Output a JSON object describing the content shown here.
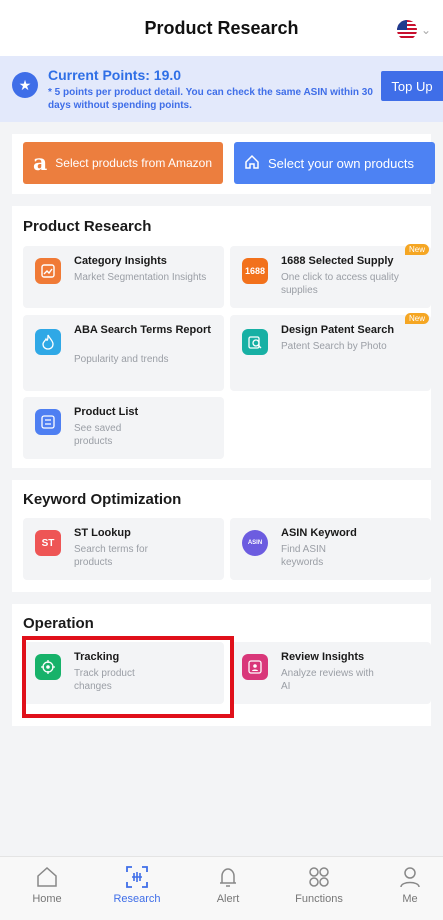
{
  "header": {
    "title": "Product Research",
    "flag_icon": "us-flag-icon"
  },
  "points": {
    "title": "Current Points: 19.0",
    "description": "* 5 points per product detail. You can check the same ASIN within 30 days without spending points.",
    "topup_label": "Top Up"
  },
  "select": {
    "amazon_label": "Select products from Amazon",
    "own_label": "Select your own products"
  },
  "product_research": {
    "title": "Product Research",
    "cards": [
      {
        "title": "Category Insights",
        "desc": "Market Segmentation Insights",
        "icon": "chart-icon",
        "color": "#f07a36"
      },
      {
        "title": "1688 Selected Supply",
        "desc": "One click to access quality supplies",
        "icon": "1688-icon",
        "icon_text": "1688",
        "color": "#f2711c",
        "badge": "New"
      },
      {
        "title": "ABA Search Terms Report",
        "desc": "Popularity and trends",
        "icon": "flame-icon",
        "color": "#2fa8e6"
      },
      {
        "title": "Design Patent Search",
        "desc": "Patent Search by Photo",
        "icon": "photo-search-icon",
        "color": "#17b0a4",
        "badge": "New"
      },
      {
        "title": "Product List",
        "desc": "See saved products",
        "icon": "list-icon",
        "color": "#4e7ff2"
      }
    ]
  },
  "keyword": {
    "title": "Keyword Optimization",
    "cards": [
      {
        "title": "ST Lookup",
        "desc": "Search terms for products",
        "icon": "st-icon",
        "icon_text": "ST",
        "color": "#ee5555"
      },
      {
        "title": "ASIN Keyword",
        "desc": "Find ASIN keywords",
        "icon": "asin-search-icon",
        "icon_text": "ASIN",
        "color": "#6c5ce0"
      }
    ]
  },
  "operation": {
    "title": "Operation",
    "cards": [
      {
        "title": "Tracking",
        "desc": "Track product changes",
        "icon": "target-icon",
        "color": "#17b26a"
      },
      {
        "title": "Review Insights",
        "desc": "Analyze reviews with AI",
        "icon": "review-icon",
        "color": "#d9377a"
      }
    ]
  },
  "tabs": [
    {
      "label": "Home",
      "icon": "home-icon"
    },
    {
      "label": "Research",
      "icon": "research-icon",
      "active": true
    },
    {
      "label": "Alert",
      "icon": "bell-icon"
    },
    {
      "label": "Functions",
      "icon": "functions-icon"
    },
    {
      "label": "Me",
      "icon": "user-icon"
    }
  ]
}
